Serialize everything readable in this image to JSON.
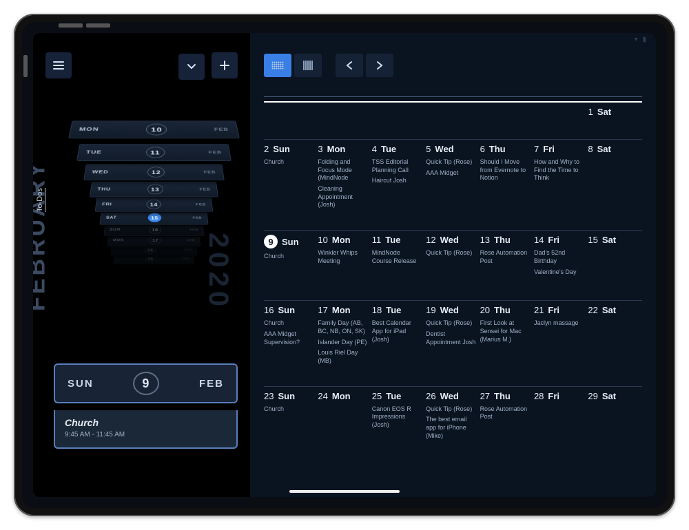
{
  "left": {
    "month_label": "FEBRUARY",
    "year_label": "2020",
    "todos_tab": "To-Dos",
    "month_badge": "FEB",
    "tiles": [
      {
        "dow": "",
        "num": "19"
      },
      {
        "dow": "",
        "num": "18"
      },
      {
        "dow": "MON",
        "num": "17"
      },
      {
        "dow": "SUN",
        "num": "16"
      },
      {
        "dow": "SAT",
        "num": "15",
        "selected": true
      },
      {
        "dow": "FRI",
        "num": "14"
      },
      {
        "dow": "THU",
        "num": "13"
      },
      {
        "dow": "WED",
        "num": "12"
      },
      {
        "dow": "TUE",
        "num": "11"
      },
      {
        "dow": "MON",
        "num": "10"
      }
    ],
    "today_tile": {
      "dow": "SUN",
      "num": "9",
      "month": "FEB"
    },
    "event": {
      "title": "Church",
      "time": "9:45 AM - 11:45 AM"
    }
  },
  "right": {
    "weeks": [
      [
        null,
        null,
        null,
        null,
        null,
        null,
        {
          "num": "1",
          "day": "Sat",
          "events": []
        }
      ],
      [
        {
          "num": "2",
          "day": "Sun",
          "events": [
            "Church"
          ]
        },
        {
          "num": "3",
          "day": "Mon",
          "events": [
            "Folding and Focus Mode (MindNode",
            "Cleaning Appointment (Josh)"
          ]
        },
        {
          "num": "4",
          "day": "Tue",
          "events": [
            "TSS Editorial Planning Call",
            "Haircut Josh"
          ]
        },
        {
          "num": "5",
          "day": "Wed",
          "events": [
            "Quick Tip (Rose)",
            "AAA Midget"
          ]
        },
        {
          "num": "6",
          "day": "Thu",
          "events": [
            "Should I Move from Evernote to Notion"
          ]
        },
        {
          "num": "7",
          "day": "Fri",
          "events": [
            "How and Why to Find the Time to Think"
          ]
        },
        {
          "num": "8",
          "day": "Sat",
          "events": []
        }
      ],
      [
        {
          "num": "9",
          "day": "Sun",
          "today": true,
          "events": [
            "Church"
          ]
        },
        {
          "num": "10",
          "day": "Mon",
          "events": [
            "Winkler Whips Meeting"
          ]
        },
        {
          "num": "11",
          "day": "Tue",
          "events": [
            "MindNode Course Release"
          ]
        },
        {
          "num": "12",
          "day": "Wed",
          "events": [
            "Quick Tip (Rose)"
          ]
        },
        {
          "num": "13",
          "day": "Thu",
          "events": [
            "Rose Automation Post"
          ]
        },
        {
          "num": "14",
          "day": "Fri",
          "events": [
            "Dad's 52nd Birthday",
            "Valentine's Day"
          ]
        },
        {
          "num": "15",
          "day": "Sat",
          "events": []
        }
      ],
      [
        {
          "num": "16",
          "day": "Sun",
          "events": [
            "Church",
            "AAA Midget Supervision?"
          ]
        },
        {
          "num": "17",
          "day": "Mon",
          "events": [
            "Family Day (AB, BC, NB, ON, SK)",
            "Islander Day (PE)",
            "Louis Riel Day (MB)"
          ]
        },
        {
          "num": "18",
          "day": "Tue",
          "events": [
            "Best Calendar App for iPad (Josh)"
          ]
        },
        {
          "num": "19",
          "day": "Wed",
          "events": [
            "Quick Tip (Rose)",
            "Dentist Appointment Josh"
          ]
        },
        {
          "num": "20",
          "day": "Thu",
          "events": [
            "First Look at Sensei for Mac (Marius M.)"
          ]
        },
        {
          "num": "21",
          "day": "Fri",
          "events": [
            "Jaclyn massage"
          ]
        },
        {
          "num": "22",
          "day": "Sat",
          "events": []
        }
      ],
      [
        {
          "num": "23",
          "day": "Sun",
          "events": [
            "Church"
          ]
        },
        {
          "num": "24",
          "day": "Mon",
          "events": []
        },
        {
          "num": "25",
          "day": "Tue",
          "events": [
            "Canon EOS R Impressions (Josh)"
          ]
        },
        {
          "num": "26",
          "day": "Wed",
          "events": [
            "Quick Tip (Rose)",
            "The best email app for iPhone (Mike)"
          ]
        },
        {
          "num": "27",
          "day": "Thu",
          "events": [
            "Rose Automation Post"
          ]
        },
        {
          "num": "28",
          "day": "Fri",
          "events": []
        },
        {
          "num": "29",
          "day": "Sat",
          "events": []
        }
      ]
    ]
  }
}
